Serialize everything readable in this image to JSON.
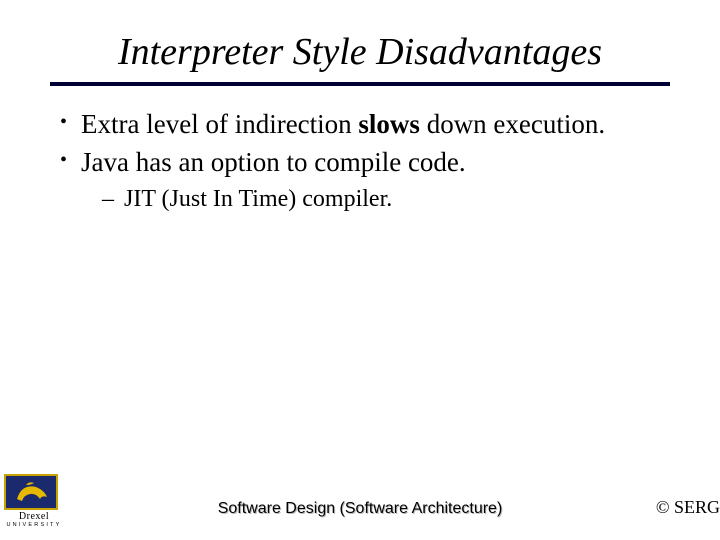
{
  "title": "Interpreter Style Disadvantages",
  "bullets": [
    {
      "prefix": "Extra level of indirection ",
      "bold": "slows",
      "suffix": " down execution."
    },
    {
      "prefix": "Java has an option to compile code.",
      "bold": "",
      "suffix": ""
    }
  ],
  "sub_bullet": "JIT (Just In Time) compiler.",
  "logo": {
    "name": "Drexel",
    "sub": "UNIVERSITY"
  },
  "footer_center": "Software Design (Software Architecture)",
  "footer_right": "© SERG"
}
